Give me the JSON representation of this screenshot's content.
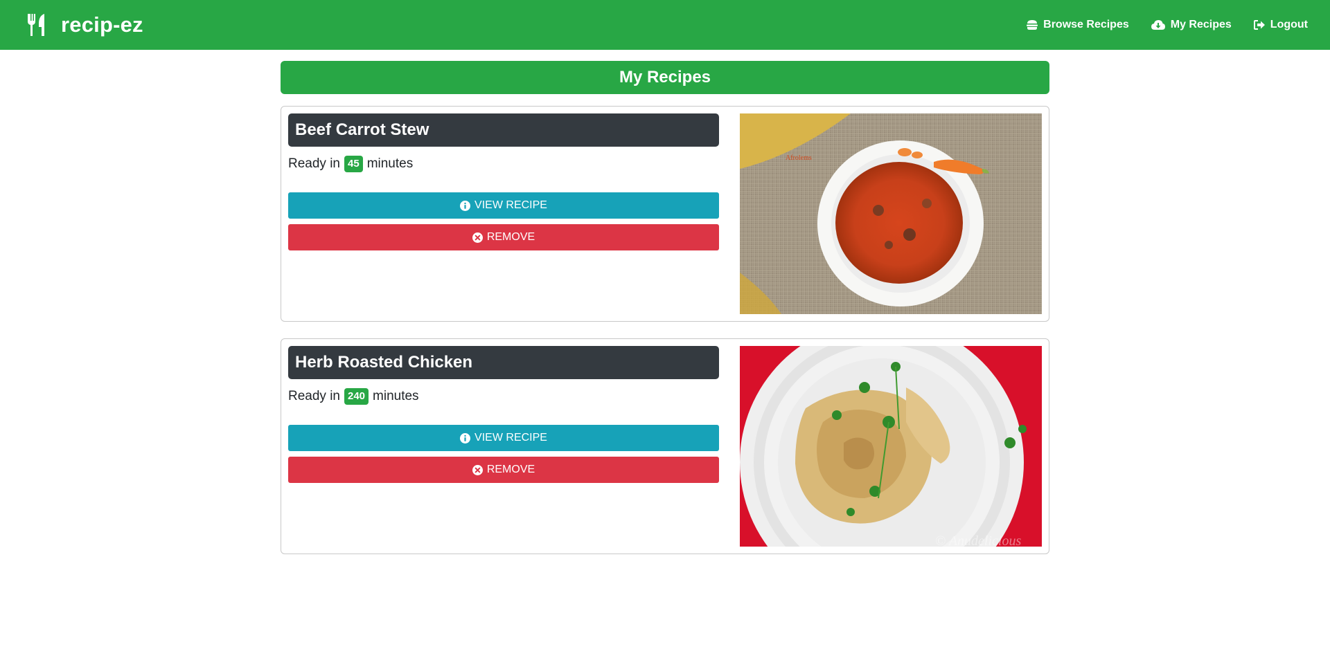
{
  "nav": {
    "brand": "recip-ez",
    "brand_icon": "utensils-icon",
    "links": [
      {
        "label": "Browse Recipes",
        "icon": "hamburger-icon"
      },
      {
        "label": "My Recipes",
        "icon": "cloud-download-icon"
      },
      {
        "label": "Logout",
        "icon": "sign-out-icon"
      }
    ]
  },
  "page": {
    "title": "My Recipes"
  },
  "recipes": [
    {
      "title": "Beef Carrot Stew",
      "ready_prefix": "Ready in",
      "minutes": "45",
      "ready_suffix": "minutes",
      "view_label": "VIEW RECIPE",
      "remove_label": "REMOVE",
      "image_watermark": "Afrolems"
    },
    {
      "title": "Herb Roasted Chicken",
      "ready_prefix": "Ready in",
      "minutes": "240",
      "ready_suffix": "minutes",
      "view_label": "VIEW RECIPE",
      "remove_label": "REMOVE",
      "image_watermark": "© Anudelicious"
    }
  ],
  "colors": {
    "primary": "#28a745",
    "dark": "#343a40",
    "info": "#17a2b8",
    "danger": "#dc3545"
  }
}
